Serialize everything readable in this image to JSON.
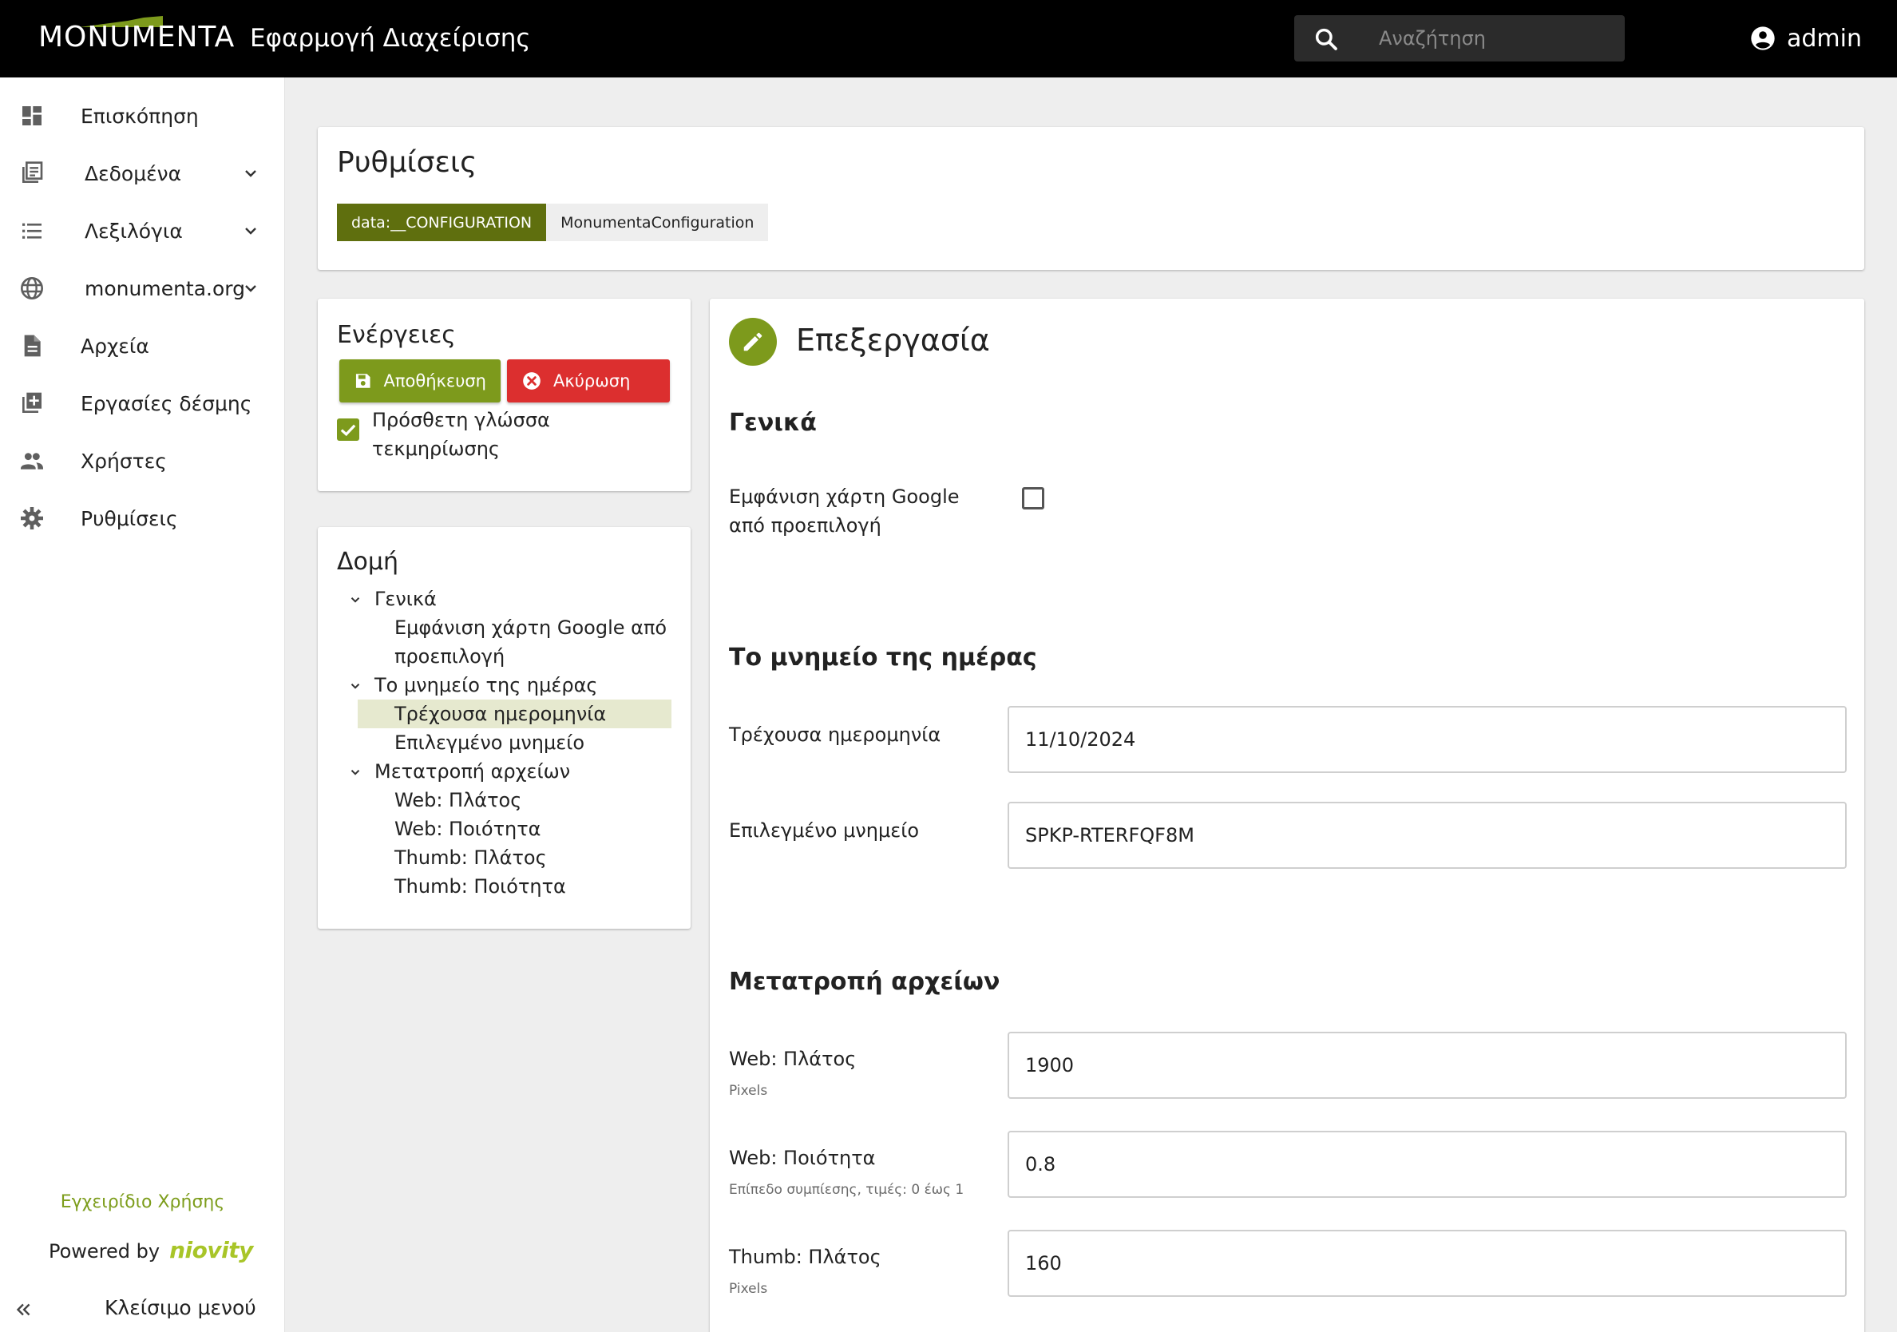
{
  "header": {
    "logo_text": "MONUMENTA",
    "app_title": "Εφαρμογή Διαχείρισης",
    "search_placeholder": "Αναζήτηση",
    "user_name": "admin"
  },
  "sidebar": {
    "items": [
      {
        "label": "Επισκόπηση",
        "icon": "dashboard-icon",
        "expandable": false
      },
      {
        "label": "Δεδομένα",
        "icon": "library-books-icon",
        "expandable": true
      },
      {
        "label": "Λεξιλόγια",
        "icon": "list-icon",
        "expandable": true
      },
      {
        "label": "monumenta.org",
        "icon": "globe-icon",
        "expandable": true
      },
      {
        "label": "Αρχεία",
        "icon": "file-icon",
        "expandable": false
      },
      {
        "label": "Εργασίες δέσμης",
        "icon": "library-add-icon",
        "expandable": false
      },
      {
        "label": "Χρήστες",
        "icon": "people-icon",
        "expandable": false
      },
      {
        "label": "Ρυθμίσεις",
        "icon": "gear-icon",
        "expandable": false
      }
    ],
    "manual_link": "Εγχειρίδιο Χρήσης",
    "powered_by": "Powered by",
    "powered_brand": "niovity",
    "close_menu": "Κλείσιμο μενού"
  },
  "page": {
    "title": "Ρυθμίσεις",
    "chips": [
      "data:__CONFIGURATION",
      "MonumentaConfiguration"
    ]
  },
  "actions": {
    "title": "Ενέργειες",
    "save_label": "Αποθήκευση",
    "cancel_label": "Ακύρωση",
    "extra_lang_label": "Πρόσθετη γλώσσα τεκμηρίωσης",
    "extra_lang_checked": true
  },
  "structure": {
    "title": "Δομή",
    "groups": [
      {
        "label": "Γενικά",
        "children": [
          "Εμφάνιση χάρτη Google από προεπιλογή"
        ]
      },
      {
        "label": "Το μνημείο της ημέρας",
        "children": [
          "Τρέχουσα ημερομηνία",
          "Επιλεγμένο μνημείο"
        ]
      },
      {
        "label": "Μετατροπή αρχείων",
        "children": [
          "Web: Πλάτος",
          "Web: Ποιότητα",
          "Thumb: Πλάτος",
          "Thumb: Ποιότητα"
        ]
      }
    ],
    "selected": "Τρέχουσα ημερομηνία"
  },
  "edit": {
    "title": "Επεξεργασία",
    "general": {
      "heading": "Γενικά",
      "google_map_label": "Εμφάνιση χάρτη Google από προεπιλογή",
      "google_map_checked": false
    },
    "monument_of_day": {
      "heading": "Το μνημείο της ημέρας",
      "current_date_label": "Τρέχουσα ημερομηνία",
      "current_date_value": "11/10/2024",
      "selected_monument_label": "Επιλεγμένο μνημείο",
      "selected_monument_value": "SPKP-RTERFQF8M"
    },
    "file_conversion": {
      "heading": "Μετατροπή αρχείων",
      "web_width_label": "Web: Πλάτος",
      "web_width_hint": "Pixels",
      "web_width_value": "1900",
      "web_quality_label": "Web: Ποιότητα",
      "web_quality_hint": "Επίπεδο συμπίεσης, τιμές: 0 έως 1",
      "web_quality_value": "0.8",
      "thumb_width_label": "Thumb: Πλάτος",
      "thumb_width_hint": "Pixels",
      "thumb_width_value": "160"
    }
  },
  "colors": {
    "accent": "#7d9a1c",
    "chip_dark": "#5f6f0e",
    "danger": "#dc2f2f",
    "selected_row": "#e6e9cf"
  }
}
